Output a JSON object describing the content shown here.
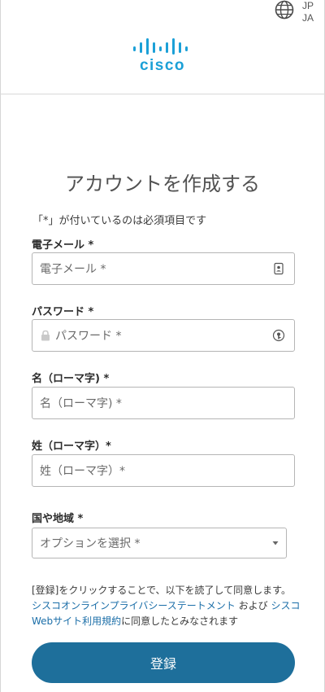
{
  "header": {
    "language_region": "JP",
    "language_code": "JA",
    "logo_text": "cisco",
    "brand_color": "#1ba0d7"
  },
  "form": {
    "title": "アカウントを作成する",
    "required_note": "「*」が付いているのは必須項目です",
    "email": {
      "label": "電子メール *",
      "placeholder": "電子メール *",
      "icon": "contact-card-icon"
    },
    "password": {
      "label": "パスワード *",
      "placeholder": "パスワード *",
      "icon": "password-key-icon"
    },
    "first_name": {
      "label": "名（ローマ字) *",
      "placeholder": "名（ローマ字) *"
    },
    "last_name": {
      "label": "姓（ローマ字）*",
      "placeholder": "姓（ローマ字）*"
    },
    "country": {
      "label": "国や地域 *",
      "selected": "オプションを選択 *"
    },
    "consent": {
      "prefix": "[登録]をクリックすることで、以下を読了して同意します。",
      "privacy_link": "シスコオンラインプライバシーステートメント",
      "middle": " および ",
      "terms_link": "シスコWebサイト利用規約",
      "suffix": "に同意したとみなされます"
    },
    "submit_label": "登録",
    "submit_color": "#1e6f9b"
  }
}
